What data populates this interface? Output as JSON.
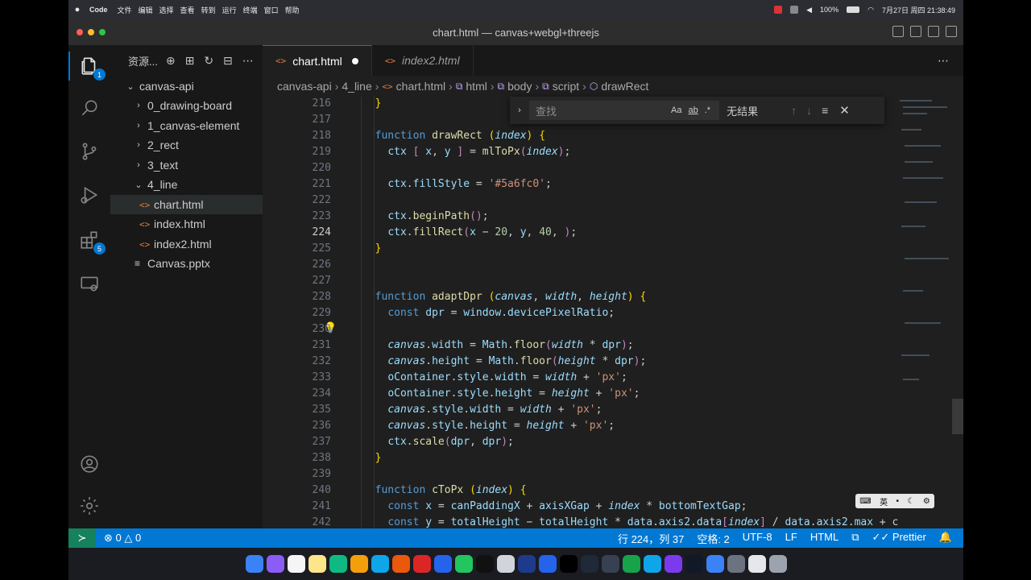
{
  "menubar": {
    "apple": "",
    "app_name": "Code",
    "items": [
      "文件",
      "编辑",
      "选择",
      "查看",
      "转到",
      "运行",
      "终端",
      "窗口",
      "帮助"
    ],
    "battery": "100%",
    "datetime": "7月27日 周四 21:38:49"
  },
  "window": {
    "title": "chart.html — canvas+webgl+threejs"
  },
  "activity_bar": {
    "explorer_badge": "1",
    "extensions_badge": "5"
  },
  "sidebar": {
    "title": "资源...",
    "root": "canvas-api",
    "items": [
      {
        "label": "0_drawing-board"
      },
      {
        "label": "1_canvas-element"
      },
      {
        "label": "2_rect"
      },
      {
        "label": "3_text"
      },
      {
        "label": "4_line"
      },
      {
        "label": "chart.html"
      },
      {
        "label": "index.html"
      },
      {
        "label": "index2.html"
      },
      {
        "label": "Canvas.pptx"
      }
    ]
  },
  "tabs": [
    {
      "label": "chart.html",
      "icon": "<>"
    },
    {
      "label": "index2.html",
      "icon": "<>"
    }
  ],
  "breadcrumb": [
    "canvas-api",
    "4_line",
    "chart.html",
    "html",
    "body",
    "script",
    "drawRect"
  ],
  "find_widget": {
    "placeholder": "查找",
    "opt_case": "Aa",
    "opt_word": "ab",
    "opt_regex": ".*",
    "result": "无结果"
  },
  "editor": {
    "line_numbers": [
      "216",
      "217",
      "218",
      "219",
      "220",
      "221",
      "222",
      "223",
      "224",
      "225",
      "226",
      "227",
      "228",
      "229",
      "230",
      "231",
      "232",
      "233",
      "234",
      "235",
      "236",
      "237",
      "238",
      "239",
      "240",
      "241",
      "242"
    ],
    "current_line": "224"
  },
  "ime": {
    "label": "英"
  },
  "statusbar": {
    "errors": "0",
    "warnings": "0",
    "position": "行 224，列 37",
    "spaces": "空格: 2",
    "encoding": "UTF-8",
    "eol": "LF",
    "language": "HTML",
    "formatter": "Prettier"
  },
  "colors": {
    "accent": "#0078d4",
    "status_remote": "#16825d",
    "editor_bg": "#1f1f1f"
  }
}
